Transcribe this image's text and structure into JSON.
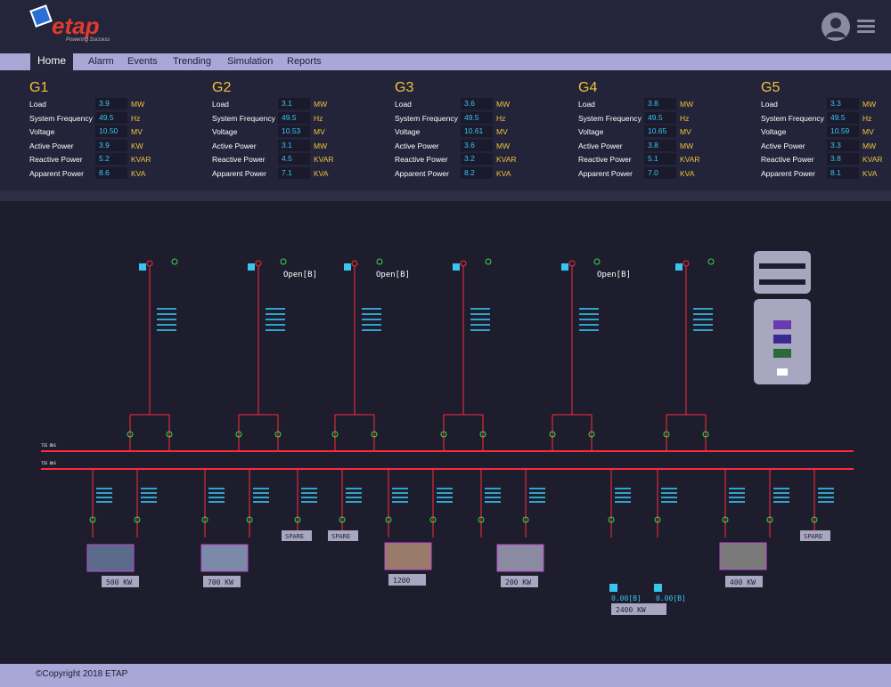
{
  "header": {
    "logo_text": "etap",
    "logo_tagline": "Powering Success"
  },
  "nav": {
    "items": [
      "Home",
      "Alarm",
      "Events",
      "Trending",
      "Simulation",
      "Reports"
    ],
    "active": "Home"
  },
  "generators": [
    {
      "name": "G1",
      "rows": [
        {
          "label": "Load",
          "value": "3.9",
          "unit": "MW"
        },
        {
          "label": "System Frequency",
          "value": "49.5",
          "unit": "Hz"
        },
        {
          "label": "Voltage",
          "value": "10.50",
          "unit": "MV"
        },
        {
          "label": "Active Power",
          "value": "3.9",
          "unit": "KW"
        },
        {
          "label": "Reactive Power",
          "value": "5.2",
          "unit": "KVAR"
        },
        {
          "label": "Apparent Power",
          "value": "8.6",
          "unit": "KVA"
        }
      ]
    },
    {
      "name": "G2",
      "rows": [
        {
          "label": "Load",
          "value": "3.1",
          "unit": "MW"
        },
        {
          "label": "System Frequency",
          "value": "49.5",
          "unit": "Hz"
        },
        {
          "label": "Voltage",
          "value": "10.53",
          "unit": "MV"
        },
        {
          "label": "Active Power",
          "value": "3.1",
          "unit": "MW"
        },
        {
          "label": "Reactive Power",
          "value": "4.5",
          "unit": "KVAR"
        },
        {
          "label": "Apparent Power",
          "value": "7.1",
          "unit": "KVA"
        }
      ]
    },
    {
      "name": "G3",
      "rows": [
        {
          "label": "Load",
          "value": "3.6",
          "unit": "MW"
        },
        {
          "label": "System Frequency",
          "value": "49.5",
          "unit": "Hz"
        },
        {
          "label": "Voltage",
          "value": "10.61",
          "unit": "MV"
        },
        {
          "label": "Active Power",
          "value": "3.6",
          "unit": "MW"
        },
        {
          "label": "Reactive Power",
          "value": "3.2",
          "unit": "KVAR"
        },
        {
          "label": "Apparent Power",
          "value": "8.2",
          "unit": "KVA"
        }
      ]
    },
    {
      "name": "G4",
      "rows": [
        {
          "label": "Load",
          "value": "3.8",
          "unit": "MW"
        },
        {
          "label": "System Frequency",
          "value": "49.5",
          "unit": "Hz"
        },
        {
          "label": "Voltage",
          "value": "10.65",
          "unit": "MV"
        },
        {
          "label": "Active Power",
          "value": "3.8",
          "unit": "MW"
        },
        {
          "label": "Reactive Power",
          "value": "5.1",
          "unit": "KVAR"
        },
        {
          "label": "Apparent Power",
          "value": "7.0",
          "unit": "KVA"
        }
      ]
    },
    {
      "name": "G5",
      "rows": [
        {
          "label": "Load",
          "value": "3.3",
          "unit": "MW"
        },
        {
          "label": "System Frequency",
          "value": "49.5",
          "unit": "Hz"
        },
        {
          "label": "Voltage",
          "value": "10.59",
          "unit": "MV"
        },
        {
          "label": "Active Power",
          "value": "3.3",
          "unit": "MW"
        },
        {
          "label": "Reactive Power",
          "value": "3.8",
          "unit": "KVAR"
        },
        {
          "label": "Apparent Power",
          "value": "8.1",
          "unit": "KVA"
        }
      ]
    }
  ],
  "diagram": {
    "open_labels": [
      "Open[B]",
      "Open[B]",
      "Open[B]"
    ],
    "load_labels": [
      "500 KW",
      "700 KW",
      "1200",
      "200 KW",
      "2400 KW",
      "400 KW"
    ],
    "spare_labels": [
      "SPARE",
      "SPARE",
      "SPARE"
    ],
    "status_values": [
      "0.00[B]",
      "0.00[B]"
    ]
  },
  "colors": {
    "bus_red": "#ff2a3a",
    "cyan": "#38c6f0",
    "green": "#3ad84a",
    "gold": "#f0c43a",
    "nav_bg": "#a9a7d6",
    "page_bg": "#23233a"
  },
  "footer": {
    "copyright": "©Copyright 2018 ETAP"
  }
}
